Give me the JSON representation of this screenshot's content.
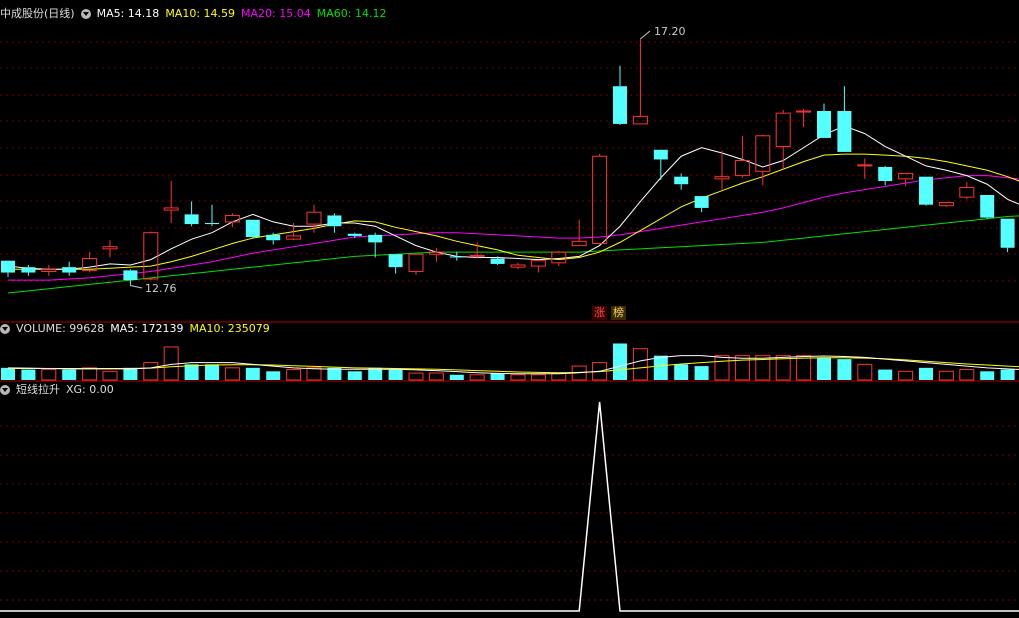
{
  "colors": {
    "up": "#ff3232",
    "down": "#54ffff",
    "ma5": "#ffffff",
    "ma10": "#ffff00",
    "ma20": "#ff00ff",
    "ma60": "#00e000",
    "grid": "#7a0000",
    "xg": "#ffffff",
    "text": "#cccccc"
  },
  "price_panel": {
    "title": "中成股份(日线)",
    "ma5_label": "MA5: 14.18",
    "ma10_label": "MA10: 14.59",
    "ma20_label": "MA20: 15.04",
    "ma60_label": "MA60: 14.12",
    "high_label": "17.20",
    "low_label": "12.76"
  },
  "volume_panel": {
    "volume_label": "VOLUME: 99628",
    "ma5_label": "MA5: 172139",
    "ma10_label": "MA10: 235079"
  },
  "indicator_panel": {
    "title": "短线拉升",
    "xg_label": "XG: 0.00"
  },
  "tags": {
    "tag1": "涨",
    "tag2": "榜"
  },
  "chart_data": {
    "type": "candlestick",
    "price_range": [
      12.35,
      17.55
    ],
    "candles": [
      {
        "o": 13.08,
        "c": 12.86,
        "h": 13.08,
        "l": 12.78,
        "v": 70000,
        "up": false
      },
      {
        "o": 12.96,
        "c": 12.86,
        "h": 13.0,
        "l": 12.8,
        "v": 60000,
        "up": false
      },
      {
        "o": 12.88,
        "c": 12.92,
        "h": 13.0,
        "l": 12.8,
        "v": 60000,
        "up": true
      },
      {
        "o": 12.96,
        "c": 12.86,
        "h": 13.06,
        "l": 12.8,
        "v": 60000,
        "up": false
      },
      {
        "o": 12.9,
        "c": 13.12,
        "h": 13.24,
        "l": 12.86,
        "v": 70000,
        "up": true
      },
      {
        "o": 13.3,
        "c": 13.34,
        "h": 13.46,
        "l": 13.14,
        "v": 50000,
        "up": true
      },
      {
        "o": 12.9,
        "c": 12.72,
        "h": 12.92,
        "l": 12.62,
        "v": 70000,
        "up": false
      },
      {
        "o": 12.74,
        "c": 13.6,
        "h": 13.62,
        "l": 12.72,
        "v": 100000,
        "up": true
      },
      {
        "o": 14.02,
        "c": 14.06,
        "h": 14.56,
        "l": 13.78,
        "v": 190000,
        "up": true
      },
      {
        "o": 13.94,
        "c": 13.76,
        "h": 14.18,
        "l": 13.72,
        "v": 90000,
        "up": false
      },
      {
        "o": 13.78,
        "c": 13.76,
        "h": 14.12,
        "l": 13.72,
        "v": 90000,
        "up": false
      },
      {
        "o": 13.8,
        "c": 13.92,
        "h": 13.96,
        "l": 13.7,
        "v": 70000,
        "up": true
      },
      {
        "o": 13.84,
        "c": 13.52,
        "h": 13.84,
        "l": 13.5,
        "v": 70000,
        "up": false
      },
      {
        "o": 13.56,
        "c": 13.46,
        "h": 13.6,
        "l": 13.38,
        "v": 50000,
        "up": false
      },
      {
        "o": 13.48,
        "c": 13.54,
        "h": 13.78,
        "l": 13.46,
        "v": 60000,
        "up": true
      },
      {
        "o": 13.76,
        "c": 13.98,
        "h": 14.12,
        "l": 13.6,
        "v": 70000,
        "up": true
      },
      {
        "o": 13.92,
        "c": 13.72,
        "h": 13.96,
        "l": 13.6,
        "v": 70000,
        "up": false
      },
      {
        "o": 13.58,
        "c": 13.54,
        "h": 13.6,
        "l": 13.5,
        "v": 50000,
        "up": false
      },
      {
        "o": 13.56,
        "c": 13.42,
        "h": 13.6,
        "l": 13.14,
        "v": 70000,
        "up": false
      },
      {
        "o": 13.2,
        "c": 12.96,
        "h": 13.2,
        "l": 12.84,
        "v": 60000,
        "up": false
      },
      {
        "o": 12.88,
        "c": 13.2,
        "h": 13.22,
        "l": 12.82,
        "v": 40000,
        "up": true
      },
      {
        "o": 13.2,
        "c": 13.24,
        "h": 13.32,
        "l": 13.06,
        "v": 40000,
        "up": true
      },
      {
        "o": 13.16,
        "c": 13.14,
        "h": 13.24,
        "l": 13.08,
        "v": 30000,
        "up": false
      },
      {
        "o": 13.16,
        "c": 13.18,
        "h": 13.42,
        "l": 13.12,
        "v": 30000,
        "up": true
      },
      {
        "o": 13.12,
        "c": 13.02,
        "h": 13.16,
        "l": 13.0,
        "v": 40000,
        "up": false
      },
      {
        "o": 12.96,
        "c": 13.0,
        "h": 13.04,
        "l": 12.92,
        "v": 30000,
        "up": true
      },
      {
        "o": 12.98,
        "c": 13.08,
        "h": 13.08,
        "l": 12.86,
        "v": 30000,
        "up": true
      },
      {
        "o": 13.04,
        "c": 13.24,
        "h": 13.26,
        "l": 12.98,
        "v": 40000,
        "up": true
      },
      {
        "o": 13.36,
        "c": 13.44,
        "h": 13.84,
        "l": 13.36,
        "v": 80000,
        "up": true
      },
      {
        "o": 13.4,
        "c": 15.02,
        "h": 15.06,
        "l": 13.38,
        "v": 100000,
        "up": true
      },
      {
        "o": 16.32,
        "c": 15.62,
        "h": 16.7,
        "l": 15.6,
        "v": 210000,
        "up": false
      },
      {
        "o": 15.62,
        "c": 15.76,
        "h": 17.2,
        "l": 15.62,
        "v": 180000,
        "up": true
      },
      {
        "o": 15.14,
        "c": 14.96,
        "h": 15.14,
        "l": 14.58,
        "v": 140000,
        "up": false
      },
      {
        "o": 14.64,
        "c": 14.5,
        "h": 14.7,
        "l": 14.4,
        "v": 90000,
        "up": false
      },
      {
        "o": 14.28,
        "c": 14.06,
        "h": 14.28,
        "l": 13.98,
        "v": 80000,
        "up": false
      },
      {
        "o": 14.6,
        "c": 14.64,
        "h": 15.12,
        "l": 14.4,
        "v": 140000,
        "up": true
      },
      {
        "o": 14.66,
        "c": 14.94,
        "h": 15.4,
        "l": 14.62,
        "v": 140000,
        "up": true
      },
      {
        "o": 14.74,
        "c": 15.4,
        "h": 15.42,
        "l": 14.48,
        "v": 140000,
        "up": true
      },
      {
        "o": 15.2,
        "c": 15.82,
        "h": 15.88,
        "l": 14.78,
        "v": 140000,
        "up": true
      },
      {
        "o": 15.84,
        "c": 15.86,
        "h": 15.9,
        "l": 15.56,
        "v": 140000,
        "up": true
      },
      {
        "o": 15.86,
        "c": 15.36,
        "h": 16.0,
        "l": 15.36,
        "v": 130000,
        "up": false
      },
      {
        "o": 15.86,
        "c": 15.1,
        "h": 16.32,
        "l": 15.1,
        "v": 120000,
        "up": false
      },
      {
        "o": 14.84,
        "c": 14.86,
        "h": 14.98,
        "l": 14.6,
        "v": 90000,
        "up": true
      },
      {
        "o": 14.82,
        "c": 14.56,
        "h": 14.84,
        "l": 14.48,
        "v": 60000,
        "up": false
      },
      {
        "o": 14.6,
        "c": 14.7,
        "h": 14.7,
        "l": 14.46,
        "v": 50000,
        "up": true
      },
      {
        "o": 14.64,
        "c": 14.12,
        "h": 14.64,
        "l": 14.1,
        "v": 70000,
        "up": false
      },
      {
        "o": 14.1,
        "c": 14.16,
        "h": 14.16,
        "l": 14.08,
        "v": 50000,
        "up": true
      },
      {
        "o": 14.26,
        "c": 14.44,
        "h": 14.54,
        "l": 14.22,
        "v": 60000,
        "up": true
      },
      {
        "o": 14.3,
        "c": 13.88,
        "h": 14.3,
        "l": 13.86,
        "v": 50000,
        "up": false
      },
      {
        "o": 13.86,
        "c": 13.32,
        "h": 13.86,
        "l": 13.24,
        "v": 60000,
        "up": false
      },
      {
        "o": 13.38,
        "c": 13.5,
        "h": 13.54,
        "l": 13.36,
        "v": 30000,
        "up": true
      }
    ],
    "ma5": [
      12.98,
      12.94,
      12.92,
      12.92,
      12.96,
      13.02,
      13.0,
      13.1,
      13.3,
      13.48,
      13.6,
      13.8,
      13.94,
      13.8,
      13.72,
      13.72,
      13.78,
      13.78,
      13.72,
      13.54,
      13.36,
      13.24,
      13.16,
      13.14,
      13.14,
      13.12,
      13.1,
      13.12,
      13.16,
      13.36,
      13.72,
      14.18,
      14.62,
      15.02,
      15.18,
      15.08,
      14.96,
      14.82,
      14.94,
      15.18,
      15.42,
      15.58,
      15.44,
      15.2,
      15.02,
      14.84,
      14.76,
      14.66,
      14.5,
      14.22,
      14.06
    ],
    "ma10": [
      12.92,
      12.92,
      12.92,
      12.92,
      12.92,
      12.94,
      12.96,
      12.98,
      13.06,
      13.16,
      13.28,
      13.4,
      13.5,
      13.56,
      13.62,
      13.68,
      13.76,
      13.82,
      13.8,
      13.7,
      13.62,
      13.54,
      13.44,
      13.36,
      13.28,
      13.18,
      13.14,
      13.1,
      13.14,
      13.24,
      13.42,
      13.64,
      13.86,
      14.08,
      14.24,
      14.38,
      14.52,
      14.64,
      14.78,
      14.92,
      15.04,
      15.06,
      15.06,
      15.04,
      15.02,
      14.98,
      14.92,
      14.84,
      14.76,
      14.64,
      14.5
    ],
    "ma20": [
      12.72,
      12.72,
      12.72,
      12.74,
      12.76,
      12.8,
      12.84,
      12.88,
      12.94,
      13.0,
      13.06,
      13.14,
      13.22,
      13.28,
      13.34,
      13.4,
      13.46,
      13.52,
      13.54,
      13.56,
      13.58,
      13.6,
      13.6,
      13.58,
      13.56,
      13.54,
      13.52,
      13.5,
      13.5,
      13.52,
      13.56,
      13.62,
      13.68,
      13.74,
      13.8,
      13.86,
      13.92,
      13.98,
      14.06,
      14.16,
      14.26,
      14.34,
      14.4,
      14.46,
      14.52,
      14.58,
      14.62,
      14.66,
      14.66,
      14.62,
      14.58
    ],
    "ma60": [
      12.48,
      12.52,
      12.56,
      12.6,
      12.64,
      12.68,
      12.72,
      12.76,
      12.8,
      12.84,
      12.88,
      12.92,
      12.96,
      13.0,
      13.04,
      13.08,
      13.12,
      13.16,
      13.18,
      13.2,
      13.22,
      13.24,
      13.24,
      13.24,
      13.24,
      13.24,
      13.24,
      13.24,
      13.24,
      13.26,
      13.28,
      13.3,
      13.32,
      13.34,
      13.36,
      13.38,
      13.4,
      13.42,
      13.46,
      13.5,
      13.54,
      13.58,
      13.62,
      13.66,
      13.7,
      13.74,
      13.78,
      13.82,
      13.86,
      13.9,
      13.92
    ],
    "vol_ma5": [
      70000,
      68000,
      66000,
      64000,
      64000,
      64000,
      64000,
      70000,
      90000,
      100000,
      100000,
      100000,
      90000,
      80000,
      70000,
      65000,
      62000,
      62000,
      62000,
      62000,
      58000,
      54000,
      48000,
      42000,
      38000,
      36000,
      36000,
      36000,
      42000,
      50000,
      80000,
      110000,
      130000,
      140000,
      140000,
      130000,
      125000,
      125000,
      130000,
      135000,
      138000,
      135000,
      130000,
      120000,
      110000,
      100000,
      90000,
      80000,
      70000,
      64000,
      58000
    ],
    "vol_ma10": [
      66000,
      66000,
      66000,
      66000,
      66000,
      66000,
      66000,
      68000,
      76000,
      82000,
      86000,
      88000,
      88000,
      86000,
      82000,
      78000,
      74000,
      70000,
      68000,
      66000,
      64000,
      62000,
      58000,
      54000,
      50000,
      46000,
      44000,
      42000,
      44000,
      48000,
      58000,
      70000,
      82000,
      92000,
      100000,
      108000,
      114000,
      118000,
      122000,
      126000,
      128000,
      128000,
      126000,
      122000,
      116000,
      108000,
      100000,
      92000,
      86000,
      80000,
      74000
    ],
    "vol_range": [
      0,
      230000
    ],
    "xg_values": [
      0,
      0,
      0,
      0,
      0,
      0,
      0,
      0,
      0,
      0,
      0,
      0,
      0,
      0,
      0,
      0,
      0,
      0,
      0,
      0,
      0,
      0,
      0,
      0,
      0,
      0,
      0,
      0,
      0,
      1,
      0,
      0,
      0,
      0,
      0,
      0,
      0,
      0,
      0,
      0,
      0,
      0,
      0,
      0,
      0,
      0,
      0,
      0,
      0,
      0,
      0
    ],
    "xg_range": [
      0,
      1
    ]
  }
}
